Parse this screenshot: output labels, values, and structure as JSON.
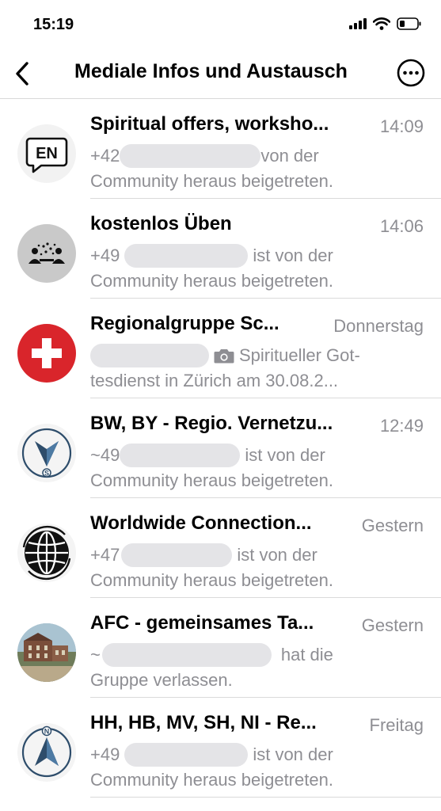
{
  "status_bar": {
    "time": "15:19"
  },
  "header": {
    "title": "Mediale Infos und Austausch"
  },
  "chats": [
    {
      "name": "Spiritual offers, worksho...",
      "time": "14:09",
      "prefix": "+42",
      "line1_suffix": "von der",
      "line2": "Community heraus beigetreten.",
      "avatar_icon": "en-speech-bubble-icon"
    },
    {
      "name": "kostenlos Üben",
      "time": "14:06",
      "prefix": "+49",
      "line1_suffix": "ist von der",
      "line2": "Community heraus beigetreten.",
      "avatar_icon": "group-people-icon"
    },
    {
      "name": "Regionalgruppe Sc...",
      "time": "Donnerstag",
      "prefix": "",
      "line1_suffix": "Spiritueller Got-",
      "line2": "tesdienst in Zürich am 30.08.2...",
      "avatar_icon": "swiss-flag-icon"
    },
    {
      "name": "BW, BY - Regio. Vernetzu...",
      "time": "12:49",
      "prefix": "~49",
      "line1_suffix": "ist von der",
      "line2": "Community heraus beigetreten.",
      "avatar_icon": "compass-south-icon"
    },
    {
      "name": "Worldwide Connection...",
      "time": "Gestern",
      "prefix": "+47",
      "line1_suffix": "ist von der",
      "line2": "Community heraus beigetreten.",
      "avatar_icon": "globe-icon"
    },
    {
      "name": "AFC - gemeinsames Ta...",
      "time": "Gestern",
      "prefix": "~",
      "line1_suffix": "hat die",
      "line2": "Gruppe verlassen.",
      "avatar_icon": "building-photo-icon"
    },
    {
      "name": "HH, HB, MV, SH, NI - Re...",
      "time": "Freitag",
      "prefix": "+49",
      "line1_suffix": "ist von der",
      "line2": "Community heraus beigetreten.",
      "avatar_icon": "compass-north-icon"
    }
  ]
}
